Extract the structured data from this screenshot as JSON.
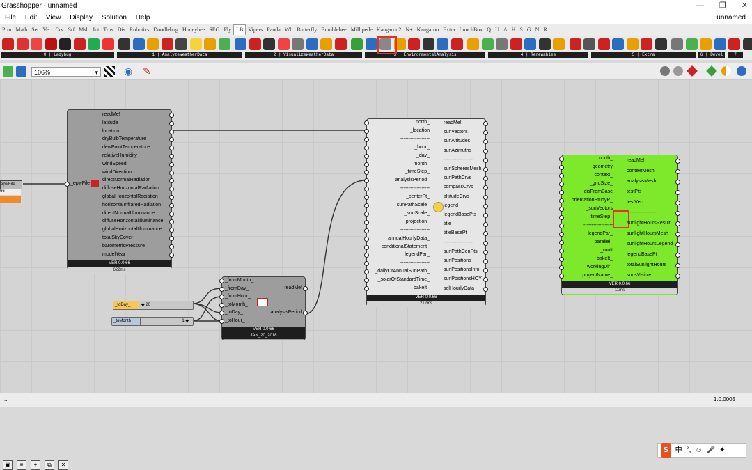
{
  "window": {
    "title": "Grasshopper - unnamed",
    "doc_name": "unnamed",
    "btn_min": "—",
    "btn_max": "❐",
    "btn_close": "✕"
  },
  "menu": [
    "File",
    "Edit",
    "View",
    "Display",
    "Solution",
    "Help"
  ],
  "tabs": [
    "Prm",
    "Math",
    "Set",
    "Vec",
    "Crv",
    "Srf",
    "Msh",
    "Int",
    "Trns",
    "Dis",
    "Robotics",
    "Doodlebug",
    "Honeybee",
    "SEG",
    "Fly",
    "LB",
    "Vipers",
    "Panda",
    "Wb",
    "Butterfly",
    "Bumblebee",
    "Millipede",
    "Kangaroo2",
    "N+",
    "Kangaroo",
    "Extra",
    "LunchBox",
    "Q",
    "U",
    "A",
    "H",
    "S",
    "G",
    "N",
    "R"
  ],
  "active_tab": "LB",
  "ribbon_groups": [
    "0 | Ladybug",
    "1 | AnalyzeWeatherData",
    "2 | VisualizeWeatherData",
    "3 | EnvironmentalAnalysis",
    "4 | Renewables",
    "5 | Extra",
    "6 | Devel",
    "7"
  ],
  "zoom": "106%",
  "components": {
    "import_epw": {
      "input": "_epwFile",
      "outputs": [
        "readMe!",
        "latitude",
        "location",
        "dryBulbTemperature",
        "dewPointTemperature",
        "relativeHumidity",
        "windSpeed",
        "windDirection",
        "directNormalRadiation",
        "diffuseHorizontalRadiation",
        "globalHorizontalRadiation",
        "horizontalInfraredRadiation",
        "directNormalIlluminance",
        "diffuseHorizontalIlluminance",
        "globalHorizontalIlluminance",
        "totalSkyCover",
        "barometricPressure",
        "modelYear"
      ],
      "version": "VER 0.0.66",
      "time": "622ms"
    },
    "epw_param": {
      "label": "epwFile",
      "value": "66"
    },
    "analysis_period": {
      "inputs": [
        "_fromMonth_",
        "_fromDay_",
        "_fromHour_",
        "_toMonth_",
        "_toDay_",
        "_toHour_"
      ],
      "outputs": [
        "readMe!",
        "analysisPeriod"
      ],
      "version": "VER 0.0.66",
      "date": "JAN_20_2018"
    },
    "slider_today": {
      "label": "_toDay_",
      "value": "◆ 20"
    },
    "slider_tomonth": {
      "label": "_toMonth",
      "value": "1 ◆"
    },
    "sunpath": {
      "inputs": [
        "north_",
        "_location",
        "------------------",
        "_hour_",
        "_day_",
        "_month_",
        "_timeStep_",
        "analysisPeriod_",
        "------------------",
        "_centerPt_",
        "_sunPathScale_",
        "_sunScale_",
        "_projection_",
        "------------------",
        "annualHourlyData_",
        "conditionalStatement_",
        "legendPar_",
        "------------------",
        "_dailyOrAnnualSunPath_",
        "_solarOrStandardTime_",
        "bakeIt_"
      ],
      "outputs": [
        "readMe!",
        "sunVectors",
        "sunAltitudes",
        "sunAzimuths",
        "------------------",
        "sunSpheresMesh",
        "sunPathCrvs",
        "compassCrvs",
        "altitudeCrvs",
        "legend",
        "legendBasePts",
        "title",
        "titleBasePt",
        "------------------",
        "sunPathCenPts",
        "sunPositions",
        "sunPositionsInfo",
        "sunPositionsHOY",
        "selHourlyData"
      ],
      "version": "VER 0.0.66",
      "time": "212ms"
    },
    "sunlight_hours": {
      "inputs": [
        "north_",
        "_geometry",
        "context_",
        "_gridSize_",
        "_disFromBase",
        "orientationStudyP_",
        "_sunVectors",
        "_timeStep_",
        "------------------",
        "legendPar_",
        "parallel_",
        "_runIt",
        "bakeIt_",
        "workingDir_",
        "projectName_"
      ],
      "outputs": [
        "readMe!",
        "contextMesh",
        "analysisMesh",
        "testPts",
        "testVec",
        "------------------",
        "sunlightHoursResult",
        "sunlightHoursMesh",
        "sunlightHoursLegend",
        "legendBasePt",
        "totalSunlightHours",
        "sunsVisible"
      ],
      "version": "VER 0.0.66",
      "time": "11ms"
    }
  },
  "status": {
    "left": "...",
    "right": "1.0.0005"
  },
  "ime": {
    "logo": "S",
    "lang": "中"
  },
  "colors": {
    "accent_green": "#7ee82a",
    "highlight_red": "#e8321f",
    "node_gray": "#9d9d9d",
    "node_light": "#e6e6e6"
  }
}
